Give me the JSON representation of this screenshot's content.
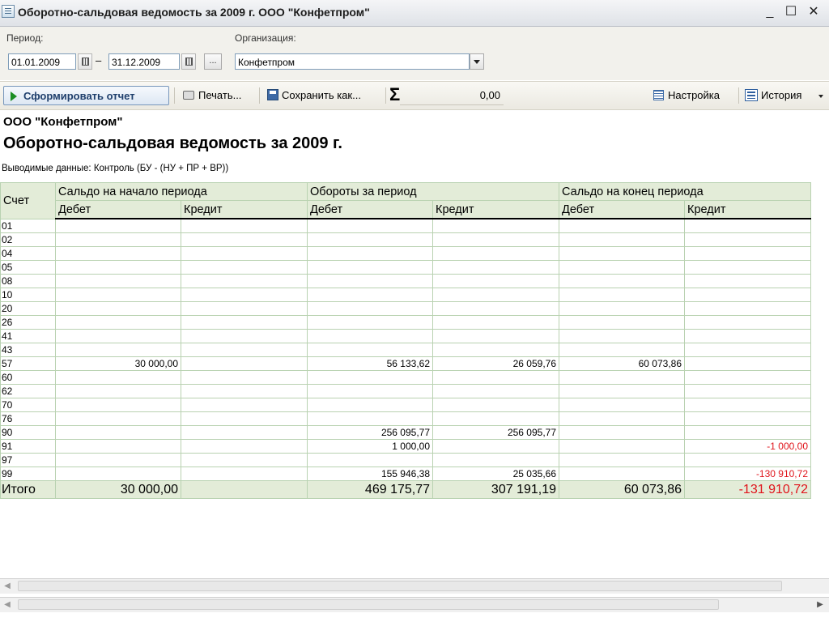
{
  "window": {
    "title": "Оборотно-сальдовая ведомость за 2009 г. ООО \"Конфетпром\"",
    "minimize": "_",
    "maximize": "☐",
    "close": "✕"
  },
  "params": {
    "period_label": "Период:",
    "period_from": "01.01.2009",
    "period_sep": "–",
    "period_to": "31.12.2009",
    "period_more": "...",
    "org_label": "Организация:",
    "org_value": "Конфетпром"
  },
  "toolbar": {
    "generate": "Сформировать отчет",
    "print": "Печать...",
    "save_as": "Сохранить как...",
    "sigma": "Σ",
    "sum_value": "0,00",
    "settings": "Настройка",
    "history": "История"
  },
  "report": {
    "organization": "ООО \"Конфетпром\"",
    "title": "Оборотно-сальдовая ведомость за 2009 г.",
    "output_label": "Выводимые данные:",
    "output_value": "Контроль (БУ - (НУ + ПР + ВР))"
  },
  "table": {
    "header": {
      "account": "Счет",
      "opening": "Сальдо на начало периода",
      "turnover": "Обороты за период",
      "closing": "Сальдо на конец периода",
      "debit": "Дебет",
      "credit": "Кредит"
    },
    "rows": [
      {
        "account": "01",
        "od": "",
        "oc": "",
        "td": "",
        "tc": "",
        "cd": "",
        "cc": ""
      },
      {
        "account": "02",
        "od": "",
        "oc": "",
        "td": "",
        "tc": "",
        "cd": "",
        "cc": ""
      },
      {
        "account": "04",
        "od": "",
        "oc": "",
        "td": "",
        "tc": "",
        "cd": "",
        "cc": ""
      },
      {
        "account": "05",
        "od": "",
        "oc": "",
        "td": "",
        "tc": "",
        "cd": "",
        "cc": ""
      },
      {
        "account": "08",
        "od": "",
        "oc": "",
        "td": "",
        "tc": "",
        "cd": "",
        "cc": ""
      },
      {
        "account": "10",
        "od": "",
        "oc": "",
        "td": "",
        "tc": "",
        "cd": "",
        "cc": ""
      },
      {
        "account": "20",
        "od": "",
        "oc": "",
        "td": "",
        "tc": "",
        "cd": "",
        "cc": ""
      },
      {
        "account": "26",
        "od": "",
        "oc": "",
        "td": "",
        "tc": "",
        "cd": "",
        "cc": ""
      },
      {
        "account": "41",
        "od": "",
        "oc": "",
        "td": "",
        "tc": "",
        "cd": "",
        "cc": ""
      },
      {
        "account": "43",
        "od": "",
        "oc": "",
        "td": "",
        "tc": "",
        "cd": "",
        "cc": ""
      },
      {
        "account": "57",
        "od": "30 000,00",
        "oc": "",
        "td": "56 133,62",
        "tc": "26 059,76",
        "cd": "60 073,86",
        "cc": ""
      },
      {
        "account": "60",
        "od": "",
        "oc": "",
        "td": "",
        "tc": "",
        "cd": "",
        "cc": ""
      },
      {
        "account": "62",
        "od": "",
        "oc": "",
        "td": "",
        "tc": "",
        "cd": "",
        "cc": ""
      },
      {
        "account": "70",
        "od": "",
        "oc": "",
        "td": "",
        "tc": "",
        "cd": "",
        "cc": ""
      },
      {
        "account": "76",
        "od": "",
        "oc": "",
        "td": "",
        "tc": "",
        "cd": "",
        "cc": ""
      },
      {
        "account": "90",
        "od": "",
        "oc": "",
        "td": "256 095,77",
        "tc": "256 095,77",
        "cd": "",
        "cc": ""
      },
      {
        "account": "91",
        "od": "",
        "oc": "",
        "td": "1 000,00",
        "tc": "",
        "cd": "",
        "cc": "-1 000,00"
      },
      {
        "account": "97",
        "od": "",
        "oc": "",
        "td": "",
        "tc": "",
        "cd": "",
        "cc": ""
      },
      {
        "account": "99",
        "od": "",
        "oc": "",
        "td": "155 946,38",
        "tc": "25 035,66",
        "cd": "",
        "cc": "-130 910,72"
      }
    ],
    "total": {
      "account": "Итого",
      "od": "30 000,00",
      "oc": "",
      "td": "469 175,77",
      "tc": "307 191,19",
      "cd": "60 073,86",
      "cc": "-131 910,72"
    }
  },
  "colors": {
    "header_bg": "#e3ecd8",
    "grid_line": "#b9d2b1",
    "negative": "#e0141b"
  }
}
